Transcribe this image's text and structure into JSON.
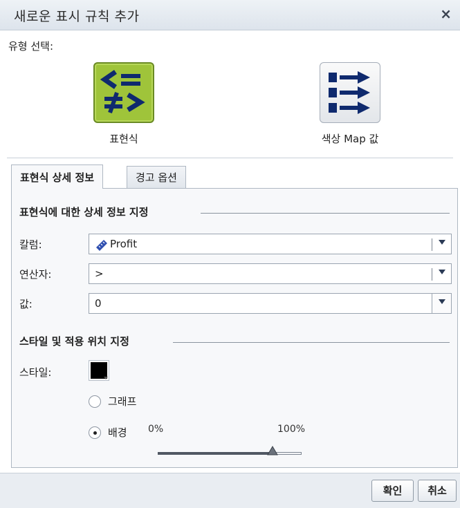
{
  "dialog": {
    "title": "새로운 표시 규칙 추가",
    "close_label": "×"
  },
  "type_select": {
    "label": "유형 선택:",
    "options": [
      {
        "label": "표현식",
        "icon": "comparison-operators-icon",
        "selected": true,
        "color": "#9fc43a"
      },
      {
        "label": "색상 Map 값",
        "icon": "color-map-arrows-icon",
        "selected": false
      }
    ]
  },
  "tabs": [
    {
      "label": "표현식 상세 정보",
      "active": true
    },
    {
      "label": "경고 옵션",
      "active": false
    }
  ],
  "expression_section": {
    "title": "표현식에 대한 상세 정보 지정",
    "column": {
      "label": "칼럼:",
      "value": "Profit",
      "icon": "measure-ruler-icon"
    },
    "operator": {
      "label": "연산자:",
      "value": ">"
    },
    "value": {
      "label": "값:",
      "value": "0"
    }
  },
  "style_section": {
    "title": "스타일 및 적용 위치 지정",
    "style_label": "스타일:",
    "style_color": "#000000",
    "apply_to": [
      {
        "label": "그래프",
        "selected": false
      },
      {
        "label": "배경",
        "selected": true
      }
    ],
    "slider": {
      "min_label": "0%",
      "max_label": "100%",
      "value_fraction": 0.8
    }
  },
  "footer": {
    "ok_label": "확인",
    "cancel_label": "취소"
  }
}
